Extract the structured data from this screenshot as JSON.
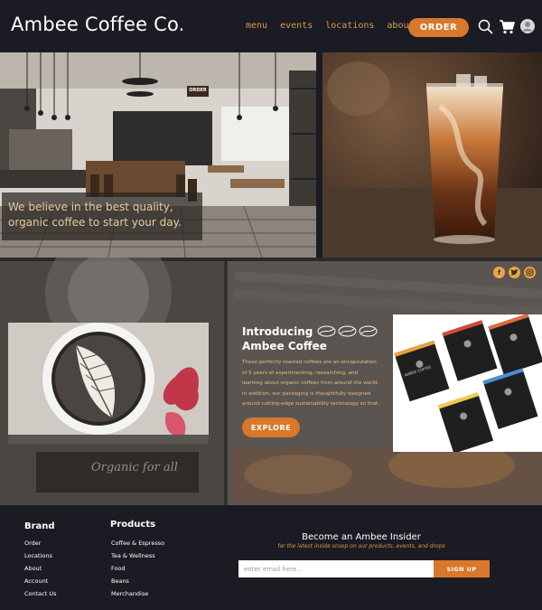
{
  "header": {
    "logo": "Ambee Coffee Co.",
    "nav": [
      "menu",
      "events",
      "locations",
      "about"
    ],
    "order_label": "ORDER",
    "icons": [
      "search-icon",
      "cart-icon",
      "user-avatar-icon"
    ]
  },
  "hero": {
    "tagline": "We believe in the best quality, organic coffee to start your day.",
    "cafe_sign": "ORDER"
  },
  "intro": {
    "title_line1": "Introducing",
    "title_line2": "Ambee Coffee",
    "body": "These perfectly roasted coffees are an encapsulation of 5 years of experimenting, researching, and learning about organic coffees from around the world. In addition, our packaging is thoughtfully designed around cutting-edge sustainability technology so that.",
    "button": "EXPLORE",
    "bean_icons": [
      "coffee-bean-icon",
      "coffee-bean-icon",
      "coffee-bean-icon"
    ],
    "social": [
      "facebook-icon",
      "twitter-icon",
      "instagram-icon"
    ],
    "wall_sign": "Organic for all",
    "package_label": "AMBEE COFFEE"
  },
  "footer": {
    "brand_heading": "Brand",
    "brand_links": [
      "Order",
      "Locations",
      "About",
      "Account",
      "Contact Us"
    ],
    "products_heading": "Products",
    "product_links": [
      "Coffee & Espresso",
      "Tea & Wellness",
      "Food",
      "Beans",
      "Merchandise"
    ],
    "insider_title": "Become an Ambee Insider",
    "insider_subtitle": "for the latest inside scoop on our products, events, and drops",
    "email_placeholder": "enter email here...",
    "signup_label": "SIGN UP"
  },
  "colors": {
    "background": "#1b1b24",
    "accent": "#d9782a",
    "accent_text": "#d89a4a"
  }
}
